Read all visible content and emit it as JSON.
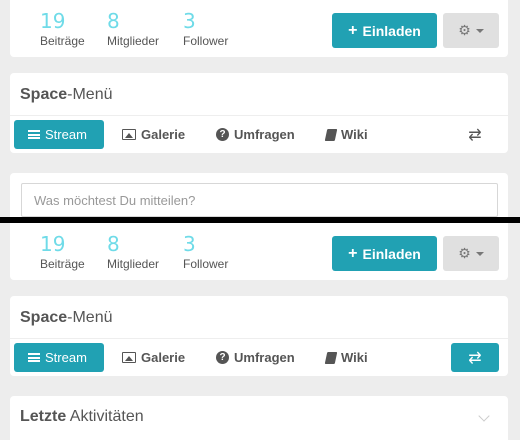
{
  "stats": {
    "posts": {
      "value": "19",
      "label": "Beiträge"
    },
    "members": {
      "value": "8",
      "label": "Mitglieder"
    },
    "followers": {
      "value": "3",
      "label": "Follower"
    }
  },
  "header": {
    "invite_label": "Einladen",
    "invite_icon": "plus-icon",
    "settings_icon": "gear-icon"
  },
  "space_menu": {
    "title_bold": "Space",
    "title_rest": "-Menü",
    "items": [
      {
        "label": "Stream",
        "icon": "bars-icon",
        "active": true
      },
      {
        "label": "Galerie",
        "icon": "image-icon"
      },
      {
        "label": "Umfragen",
        "icon": "question-circle-icon"
      },
      {
        "label": "Wiki",
        "icon": "book-icon"
      }
    ],
    "toggle_icon": "exchange-icon"
  },
  "post": {
    "placeholder": "Was möchtest Du mitteilen?"
  },
  "activity": {
    "title_bold": "Letzte",
    "title_rest": " Aktivitäten"
  },
  "colors": {
    "accent": "#21a1b3",
    "stat_number": "#6fdbe8",
    "background": "#ededed"
  }
}
